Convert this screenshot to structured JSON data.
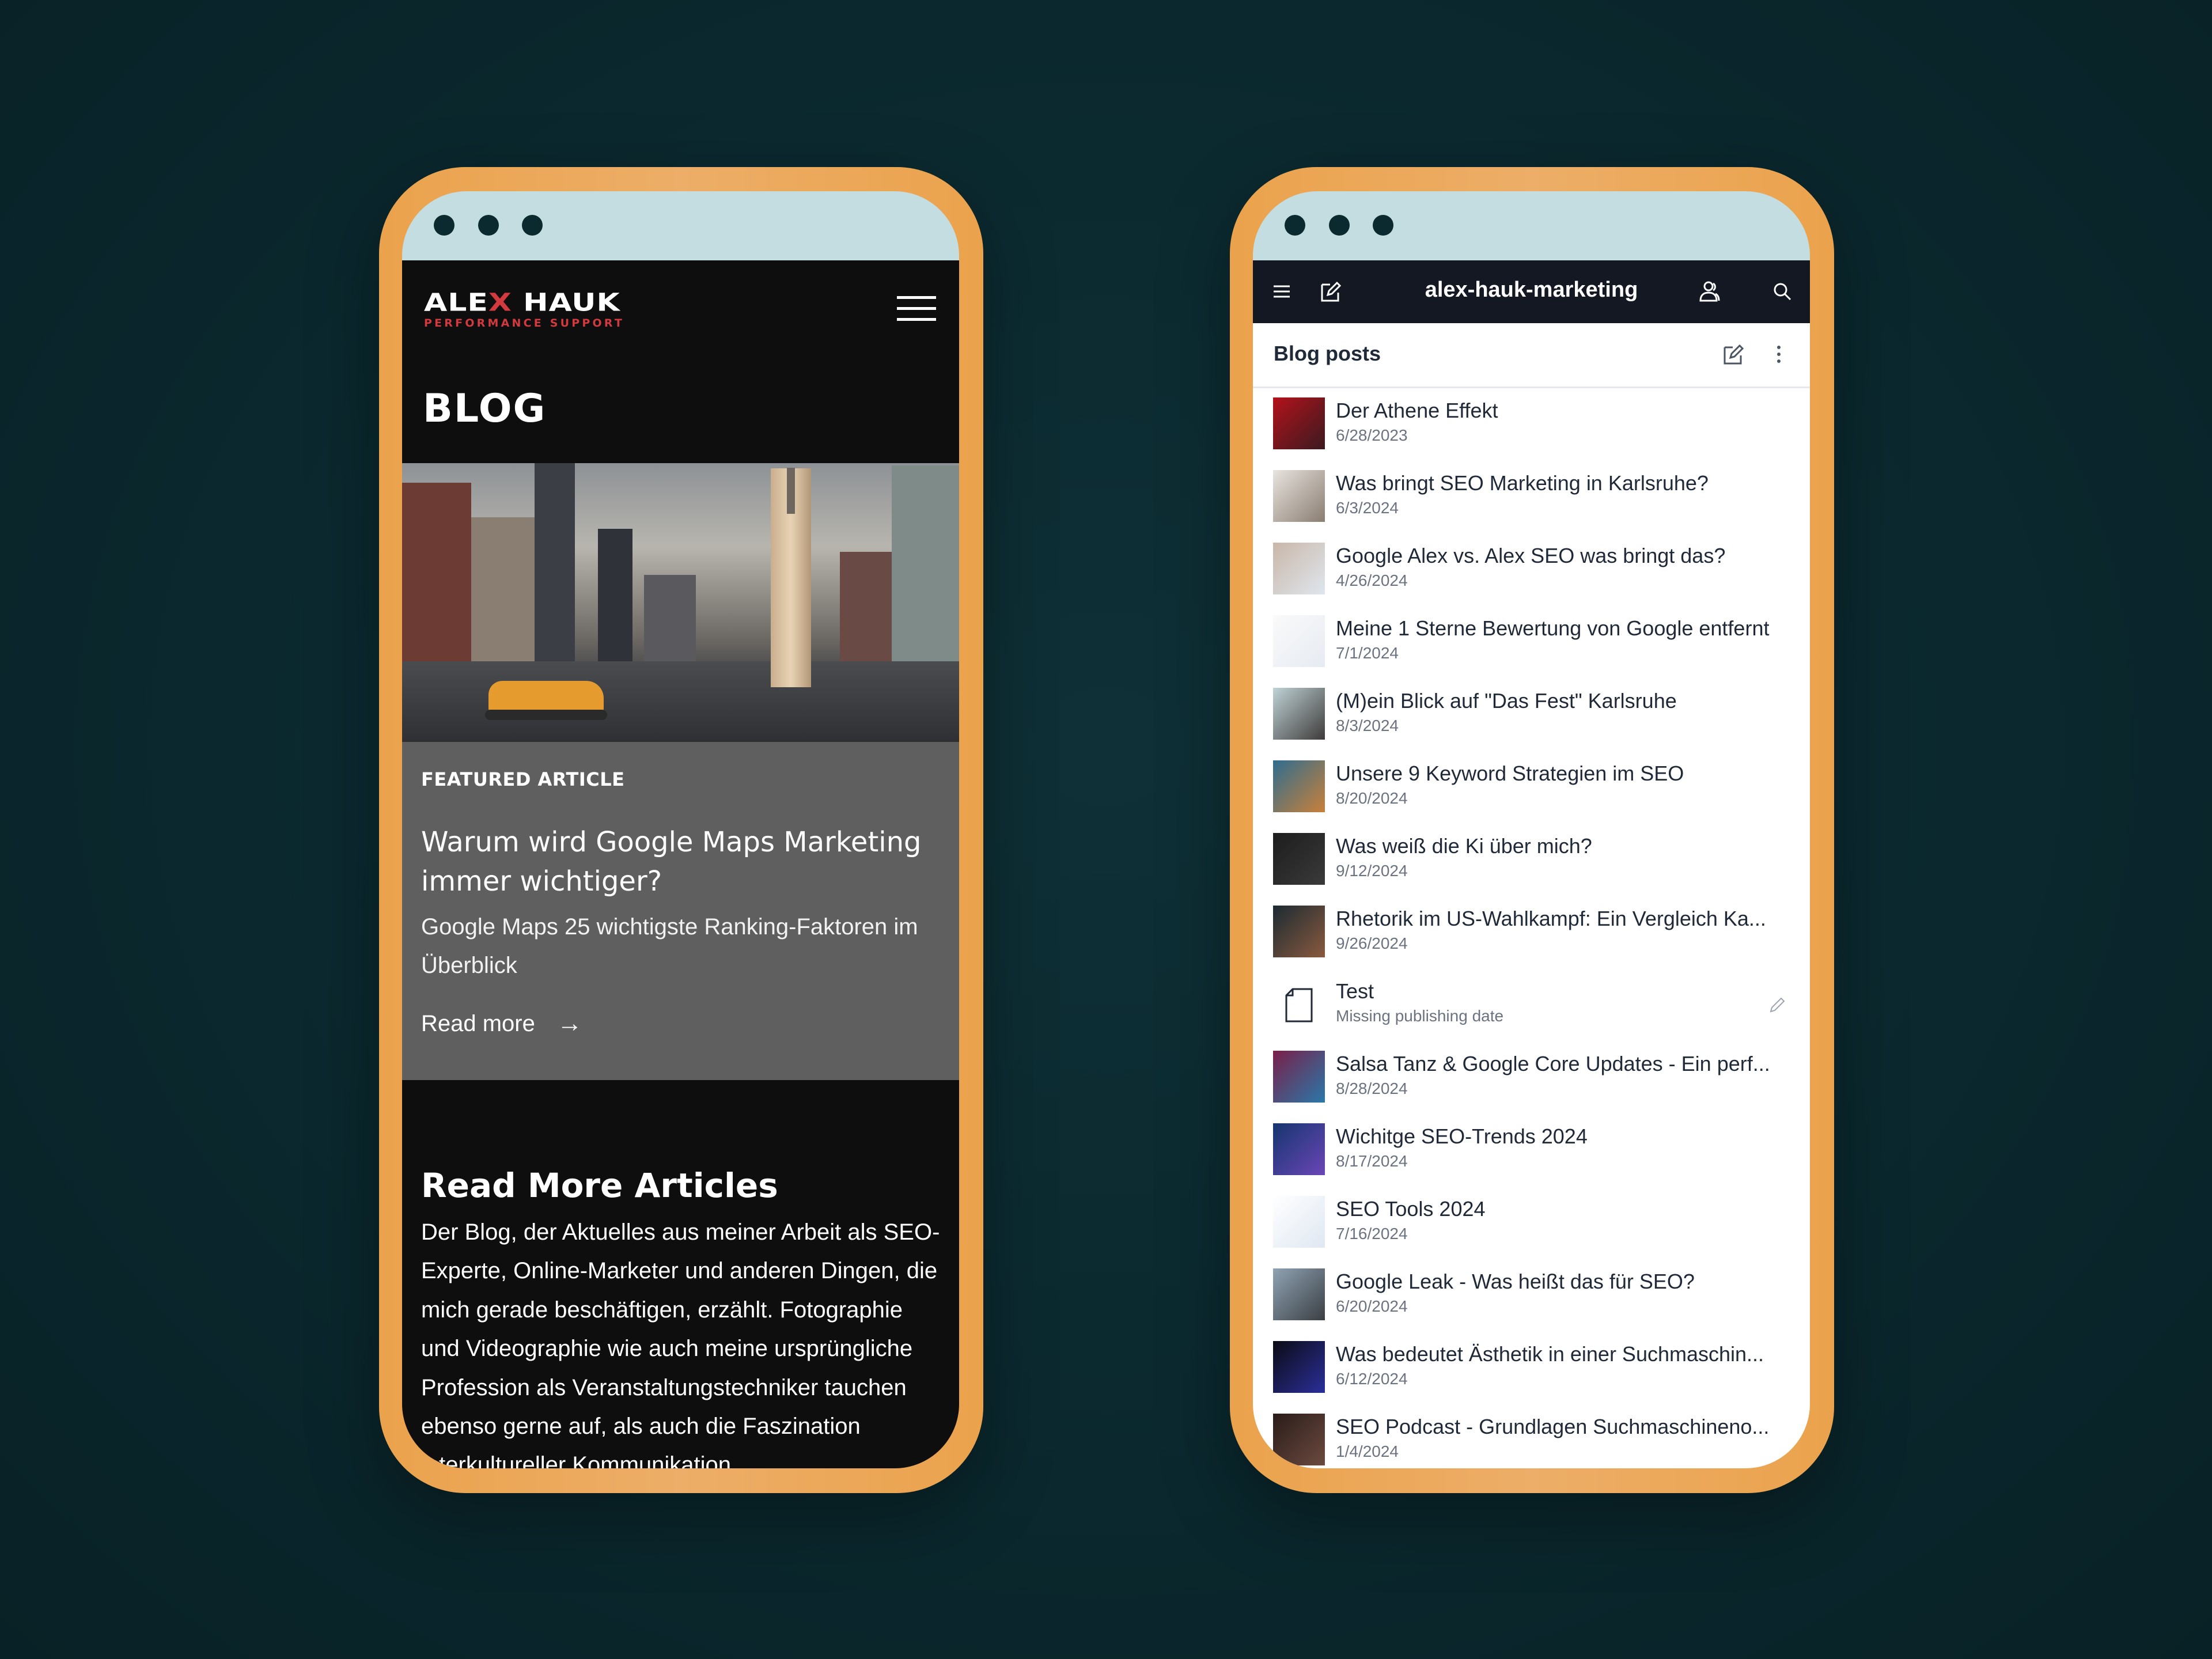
{
  "left_phone": {
    "logo": {
      "main_before": "ALE",
      "main_x": "X",
      "main_after": " HAUK",
      "sub": "PERFORMANCE SUPPORT"
    },
    "menu_icon": "hamburger-icon",
    "page_title": "BLOG",
    "featured": {
      "label": "FEATURED ARTICLE",
      "title": "Warum wird Google Maps Marketing immer wichtiger?",
      "subtitle": "Google Maps 25 wichtigste Ranking-Faktoren im Überblick",
      "read_more": "Read more",
      "arrow_icon": "→"
    },
    "more": {
      "title": "Read More Articles",
      "text": "Der Blog, der Aktuelles aus meiner Arbeit als SEO-Experte, Online-Marketer und anderen Dingen, die mich gerade beschäftigen, erzählt. Fotographie und Videographie wie auch meine ursprüngliche Profession als Veranstaltungstechniker tauchen ebenso gerne auf, als auch die Faszination interkultureller Kommunikation."
    }
  },
  "right_phone": {
    "header": {
      "title": "alex-hauk-marketing"
    },
    "bar": {
      "title": "Blog posts"
    },
    "posts": [
      {
        "title": "Der Athene Effekt",
        "date": "6/28/2023",
        "thumb": [
          "#b3121b",
          "#3a1a20"
        ]
      },
      {
        "title": "Was bringt SEO Marketing in Karlsruhe?",
        "date": "6/3/2024",
        "thumb": [
          "#e8e4df",
          "#8a7d72"
        ]
      },
      {
        "title": "Google Alex vs. Alex SEO was bringt das?",
        "date": "4/26/2024",
        "thumb": [
          "#c9b7a8",
          "#dfe6ee"
        ]
      },
      {
        "title": "Meine 1 Sterne Bewertung von Google entfernt",
        "date": "7/1/2024",
        "thumb": [
          "#fafafa",
          "#e6ebf2"
        ]
      },
      {
        "title": "(M)ein Blick auf \"Das Fest\" Karlsruhe",
        "date": "8/3/2024",
        "thumb": [
          "#bfd3d6",
          "#3e3b3a"
        ]
      },
      {
        "title": "Unsere 9 Keyword Strategien im SEO",
        "date": "8/20/2024",
        "thumb": [
          "#2f6d8f",
          "#c9803a"
        ]
      },
      {
        "title": "Was weiß die Ki über mich?",
        "date": "9/12/2024",
        "thumb": [
          "#1d1d1d",
          "#3a3a3a"
        ]
      },
      {
        "title": "Rhetorik im US-Wahlkampf: Ein Vergleich Ka...",
        "date": "9/26/2024",
        "thumb": [
          "#1c2a33",
          "#8a5a3e"
        ]
      },
      {
        "title": "Test",
        "date": "Missing publishing date",
        "thumb": null,
        "editable": true
      },
      {
        "title": "Salsa Tanz & Google Core Updates - Ein perf...",
        "date": "8/28/2024",
        "thumb": [
          "#7a1f4a",
          "#2a78a8"
        ]
      },
      {
        "title": "Wichitge SEO-Trends 2024",
        "date": "8/17/2024",
        "thumb": [
          "#16356e",
          "#6a46b8"
        ]
      },
      {
        "title": "SEO Tools 2024",
        "date": "7/16/2024",
        "thumb": [
          "#ffffff",
          "#dfe7f2"
        ]
      },
      {
        "title": "Google Leak - Was heißt das für SEO?",
        "date": "6/20/2024",
        "thumb": [
          "#8fa3b4",
          "#3b3f43"
        ]
      },
      {
        "title": "Was bedeutet Ästhetik in einer Suchmaschin...",
        "date": "6/12/2024",
        "thumb": [
          "#0b0b14",
          "#2b2f9a"
        ]
      },
      {
        "title": "SEO Podcast - Grundlagen Suchmaschineno...",
        "date": "1/4/2024",
        "thumb": [
          "#2a1c1a",
          "#6b4a3f"
        ]
      }
    ]
  },
  "colors": {
    "background": "#0b2a30",
    "bezel": "#eba24c",
    "chrome_bar": "#c3dde0",
    "window_dot": "#0b2a2f",
    "site_bg": "#0e0e0e",
    "featured_bg": "#5f5f5f",
    "brand_red": "#d23a3f",
    "cms_header": "#131822"
  }
}
